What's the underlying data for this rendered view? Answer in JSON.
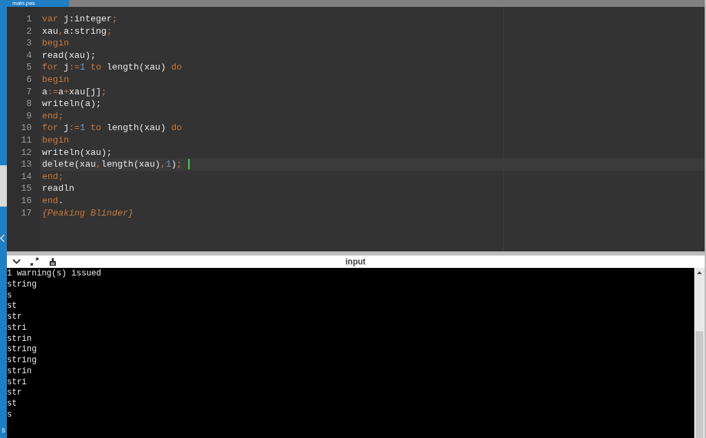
{
  "tab": {
    "label": "main.pas",
    "selected": true
  },
  "side_strip": {
    "label": "s"
  },
  "editor": {
    "lines": [
      {
        "number": "1",
        "current": false,
        "tokens": [
          {
            "kind": "keyword",
            "text": "var"
          },
          {
            "kind": "plain",
            "text": " j:integer"
          },
          {
            "kind": "punct",
            "text": ";"
          }
        ]
      },
      {
        "number": "2",
        "current": false,
        "tokens": [
          {
            "kind": "plain",
            "text": "xau"
          },
          {
            "kind": "punct",
            "text": ","
          },
          {
            "kind": "plain",
            "text": "a:string"
          },
          {
            "kind": "punct",
            "text": ";"
          }
        ]
      },
      {
        "number": "3",
        "current": false,
        "tokens": [
          {
            "kind": "keyword",
            "text": "begin"
          }
        ]
      },
      {
        "number": "4",
        "current": false,
        "tokens": [
          {
            "kind": "plain",
            "text": "read(xau);"
          }
        ]
      },
      {
        "number": "5",
        "current": false,
        "tokens": [
          {
            "kind": "keyword",
            "text": "for"
          },
          {
            "kind": "plain",
            "text": " j"
          },
          {
            "kind": "punct",
            "text": ":="
          },
          {
            "kind": "number",
            "text": "1"
          },
          {
            "kind": "keyword",
            "text": " to"
          },
          {
            "kind": "plain",
            "text": " length(xau)"
          },
          {
            "kind": "keyword",
            "text": " do"
          }
        ]
      },
      {
        "number": "6",
        "current": false,
        "tokens": [
          {
            "kind": "keyword",
            "text": "begin"
          }
        ]
      },
      {
        "number": "7",
        "current": false,
        "tokens": [
          {
            "kind": "plain",
            "text": "a"
          },
          {
            "kind": "punct",
            "text": ":="
          },
          {
            "kind": "plain",
            "text": "a"
          },
          {
            "kind": "punct",
            "text": "+"
          },
          {
            "kind": "plain",
            "text": "xau[j]"
          },
          {
            "kind": "punct",
            "text": ";"
          }
        ]
      },
      {
        "number": "8",
        "current": false,
        "tokens": [
          {
            "kind": "plain",
            "text": "writeln(a);"
          }
        ]
      },
      {
        "number": "9",
        "current": false,
        "tokens": [
          {
            "kind": "keyword",
            "text": "end;"
          }
        ]
      },
      {
        "number": "10",
        "current": false,
        "tokens": [
          {
            "kind": "keyword",
            "text": "for"
          },
          {
            "kind": "plain",
            "text": " j"
          },
          {
            "kind": "punct",
            "text": ":="
          },
          {
            "kind": "number",
            "text": "1"
          },
          {
            "kind": "keyword",
            "text": " to"
          },
          {
            "kind": "plain",
            "text": " length(xau)"
          },
          {
            "kind": "keyword",
            "text": " do"
          }
        ]
      },
      {
        "number": "11",
        "current": false,
        "tokens": [
          {
            "kind": "keyword",
            "text": "begin"
          }
        ]
      },
      {
        "number": "12",
        "current": false,
        "tokens": [
          {
            "kind": "plain",
            "text": "writeln(xau);"
          }
        ]
      },
      {
        "number": "13",
        "current": true,
        "tokens": [
          {
            "kind": "plain",
            "text": "delete(xau"
          },
          {
            "kind": "punct",
            "text": ","
          },
          {
            "kind": "plain",
            "text": "length(xau)"
          },
          {
            "kind": "punct",
            "text": ","
          },
          {
            "kind": "number",
            "text": "1"
          },
          {
            "kind": "plain",
            "text": ")"
          },
          {
            "kind": "punct",
            "text": ";"
          }
        ]
      },
      {
        "number": "14",
        "current": false,
        "tokens": [
          {
            "kind": "keyword",
            "text": "end;"
          }
        ]
      },
      {
        "number": "15",
        "current": false,
        "tokens": [
          {
            "kind": "plain",
            "text": "readln"
          }
        ]
      },
      {
        "number": "16",
        "current": false,
        "tokens": [
          {
            "kind": "keyword",
            "text": "end"
          },
          {
            "kind": "plain",
            "text": "."
          }
        ]
      },
      {
        "number": "17",
        "current": false,
        "tokens": [
          {
            "kind": "comment",
            "text": "{Peaking Blinder}"
          }
        ]
      }
    ]
  },
  "console": {
    "title": "input",
    "output": [
      "1 warning(s) issued",
      "string",
      "s",
      "st",
      "str",
      "stri",
      "strin",
      "string",
      "string",
      "strin",
      "stri",
      "str",
      "st",
      "s"
    ]
  }
}
